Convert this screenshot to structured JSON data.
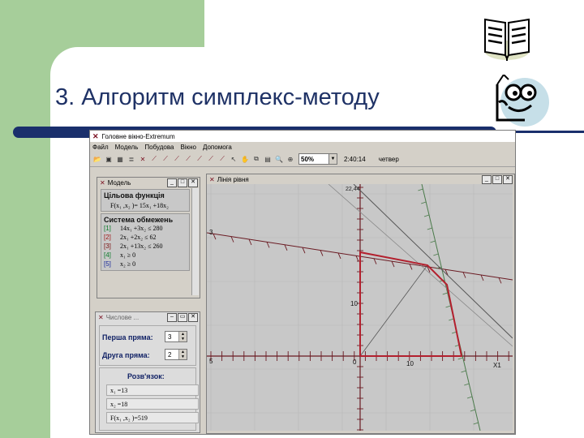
{
  "slide": {
    "title": "3. Алгоритм симплекс-методу"
  },
  "app": {
    "window_title": "Головне вікно-Extremum",
    "menu": [
      "Файл",
      "Модель",
      "Побудова",
      "Вікно",
      "Допомога"
    ],
    "toolbar": {
      "zoom": "50%",
      "time": "2:40:14",
      "day": "четвер"
    }
  },
  "model_panel": {
    "title": "Модель",
    "objective_header": "Цільова функція",
    "objective": "F(x₁ ,x₂ )= 15x₁ +18x₂",
    "constraints_header": "Система обмежень",
    "constraints": [
      {
        "idx": "[1]",
        "text": "14x₁ +3x₂ ≤ 280",
        "color": "#0a7a2a"
      },
      {
        "idx": "[2]",
        "text": "2x₁ +2x₂ ≤ 62",
        "color": "#a01818"
      },
      {
        "idx": "[3]",
        "text": "2x₁ +13x₂ ≤ 260",
        "color": "#7a1010"
      },
      {
        "idx": "[4]",
        "text": "x₁ ≥ 0",
        "color": "#0a7a2a"
      },
      {
        "idx": "[5]",
        "text": "x₂ ≥ 0",
        "color": "#1a2a9a"
      }
    ]
  },
  "numeric_panel": {
    "title": "Числове ...",
    "first_line_label": "Перша пряма:",
    "first_line_value": "3",
    "second_line_label": "Друга пряма:",
    "second_line_value": "2",
    "solution_header": "Розв'язок:",
    "results": [
      "x₁ =13",
      "x₂ =18",
      "F(x₁ ,x₂ )=519"
    ]
  },
  "plot_panel": {
    "title": "Лінія рівня",
    "labels": {
      "y_top": "22,44",
      "line3": "3",
      "y10": "10",
      "x0": "0",
      "x10": "10",
      "xneg": "5",
      "xaxis": "X1"
    }
  },
  "colors": {
    "title": "#1f3266",
    "green": "#a6ce9a",
    "rule": "#1a2f6c",
    "feasible": "#b3202e"
  }
}
